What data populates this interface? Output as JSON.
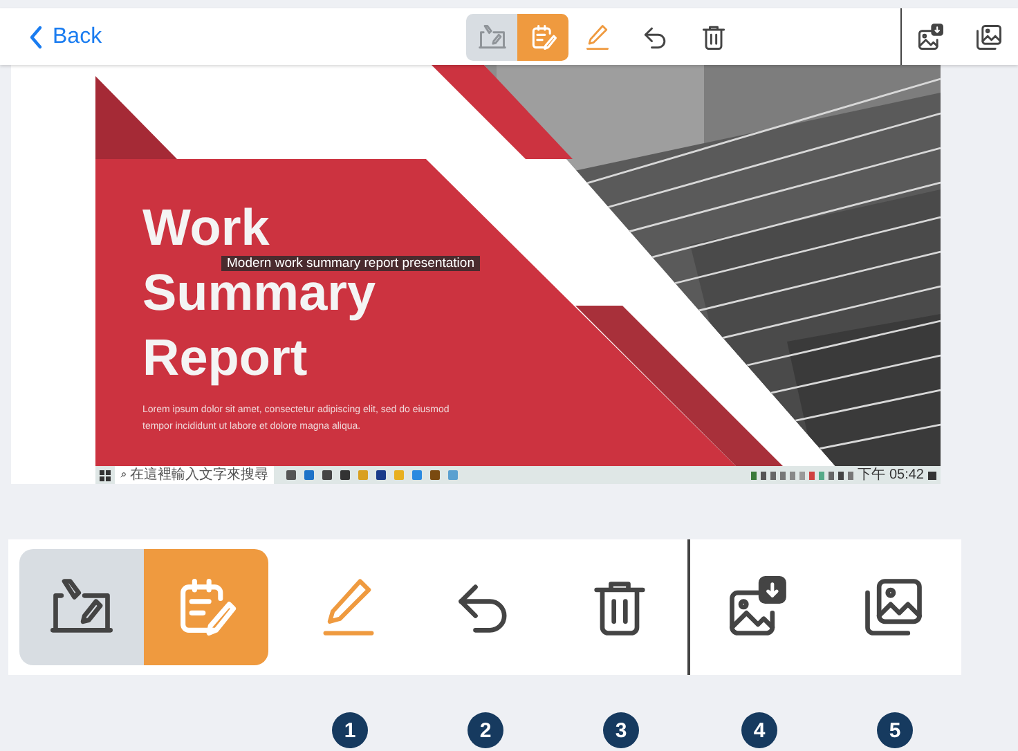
{
  "top_bar": {
    "back_label": "Back",
    "modes": [
      {
        "kind": "board",
        "selected": false
      },
      {
        "kind": "notes",
        "selected": true
      }
    ],
    "pen": {
      "active": true
    }
  },
  "slide": {
    "title_lines": [
      "Work",
      "Summary",
      "Report"
    ],
    "body_lines": [
      "Lorem ipsum dolor sit amet, consectetur adipiscing elit, sed do eiusmod",
      "tempor incididunt ut labore et dolore magna aliqua."
    ],
    "tooltip": "Modern work summary report presentation",
    "taskbar": {
      "search_placeholder": "在這裡輸入文字來搜尋",
      "clock": "下午 05:42"
    }
  },
  "toolbar": {
    "modes": [
      {
        "kind": "board",
        "selected": false
      },
      {
        "kind": "notes",
        "selected": true
      }
    ],
    "pen": {
      "active": true
    }
  },
  "callouts": [
    "1",
    "2",
    "3",
    "4",
    "5"
  ]
}
